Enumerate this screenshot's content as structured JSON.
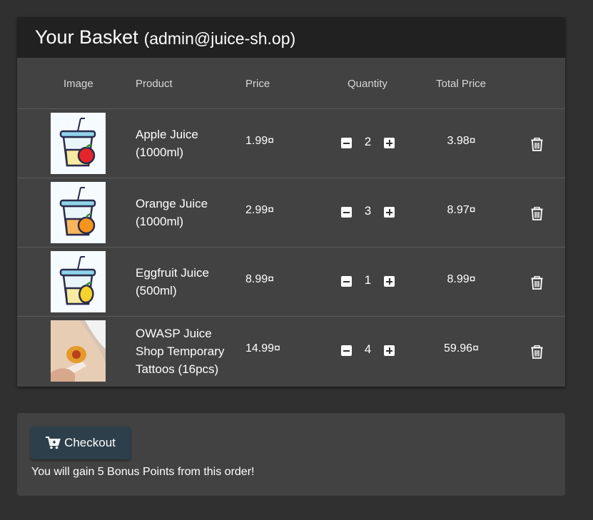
{
  "basket": {
    "title": "Your Basket",
    "user": "(admin@juice-sh.op)"
  },
  "columns": {
    "image": "Image",
    "product": "Product",
    "price": "Price",
    "quantity": "Quantity",
    "total": "Total Price"
  },
  "items": [
    {
      "name": "Apple Juice (1000ml)",
      "price": "1.99¤",
      "quantity": "2",
      "total": "3.98¤",
      "image_icon": "apple-juice-icon"
    },
    {
      "name": "Orange Juice (1000ml)",
      "price": "2.99¤",
      "quantity": "3",
      "total": "8.97¤",
      "image_icon": "orange-juice-icon"
    },
    {
      "name": "Eggfruit Juice (500ml)",
      "price": "8.99¤",
      "quantity": "1",
      "total": "8.99¤",
      "image_icon": "eggfruit-juice-icon"
    },
    {
      "name": "OWASP Juice Shop Temporary Tattoos (16pcs)",
      "price": "14.99¤",
      "quantity": "4",
      "total": "59.96¤",
      "image_icon": "tattoo-photo"
    }
  ],
  "checkout": {
    "button_label": "Checkout",
    "bonus_text": "You will gain 5 Bonus Points from this order!"
  },
  "colors": {
    "background": "#303030",
    "card": "#424242",
    "heading": "#212121",
    "checkout_button": "#2d3f4b"
  }
}
